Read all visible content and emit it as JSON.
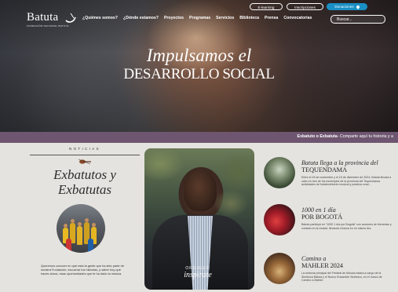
{
  "header": {
    "logo_text": "Batuta",
    "logo_subtitle": "FUNDACIÓN NACIONAL BATUTA",
    "nav_items": [
      "¿Quiénes somos?",
      "¿Dónde estamos?",
      "Proyectos",
      "Programas",
      "Servicios",
      "Biblioteca",
      "Prensa",
      "Convocatorias"
    ],
    "top_links": {
      "elearning": "E-learning",
      "inscripciones": "Inscripciones",
      "donaciones": "Donaciones"
    },
    "search_placeholder": "Buscar..."
  },
  "hero": {
    "line1": "Impulsamos el",
    "line2": "DESARROLLO SOCIAL"
  },
  "ticker": {
    "bold": "Exbatuto o Exbatuta",
    "text": "- Comparte aquí tu historia y a"
  },
  "news": {
    "label": "NOTICIAS",
    "title_line1": "Exbatutos y",
    "title_line2": "Exbatutas",
    "description": "Queremos conocer en qué está la gente que ha sido parte de nuestra Fundación, escuchar tus historias, y saber hoy qué haces ahora, esas oportunidades que te ha dado la música."
  },
  "feature": {
    "badge_top": "ORGULLO",
    "badge_bottom": "inspirate"
  },
  "side_news": [
    {
      "title_italic": "Batuta llega a la provincia del",
      "title_upper": "TEQUENDAMA",
      "text": "Entre el 15 de noviembre y el 15 de diciembre de 2024, Batuta llevará a cabo en tres de los municipios de la provincia del Tequendama actividades de fortalecimiento musical y práctica coral..."
    },
    {
      "title_italic": "1000 en 1 día",
      "title_upper": "POR BOGOTÁ",
      "text": "Batuta participó en \"1000 1 día por Bogotá\" con acciones de bienestar y cuidado en la ciudad, llevando música en un mismo día."
    },
    {
      "title_italic": "Camino a",
      "title_upper": "MAHLER 2024",
      "text": "La sinfonía principal del Festival de Música estará a cargo de la Sinfónica Batuta y el Nuevo Ensamble Sinfónico, en el marco de Camino a Mahler."
    }
  ]
}
